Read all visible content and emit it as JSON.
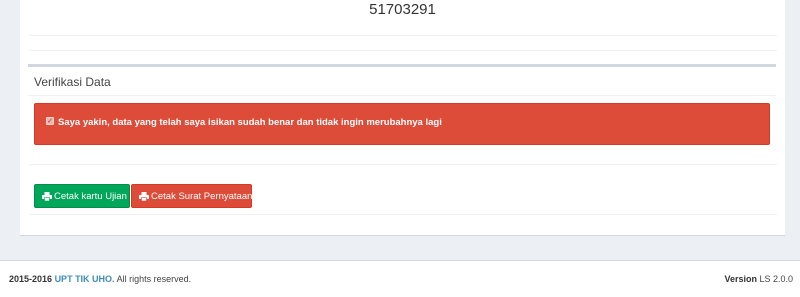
{
  "top": {
    "number": "51703291"
  },
  "verifikasi": {
    "title": "Verifikasi Data",
    "checkbox_checked": true,
    "statement": "Saya yakin, data yang telah saya isikan sudah benar dan tidak ingin merubahnya lagi",
    "alert_color": "#dd4b39"
  },
  "actions": {
    "cetak_kartu_label": "Cetak kartu Ujian",
    "cetak_surat_label": "Cetak Surat Pernyataan",
    "icon": "printer-icon",
    "colors": {
      "success": "#00a65a",
      "danger": "#dd4b39"
    }
  },
  "footer": {
    "years": "2015-2016",
    "org": "UPT TIK UHO.",
    "rights": "All rights reserved.",
    "version_label": "Version",
    "version_value": "LS 2.0.0",
    "link_color": "#3c8dbc"
  }
}
